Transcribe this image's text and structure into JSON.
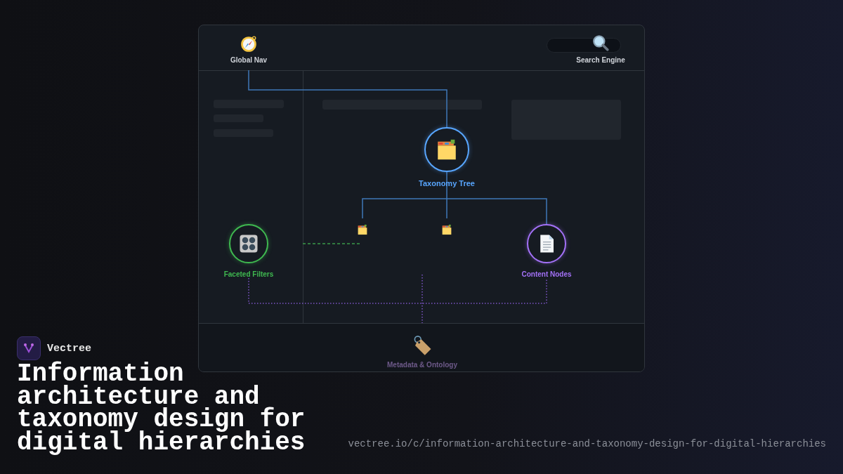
{
  "diagram": {
    "nodes": [
      {
        "label": "Global Nav",
        "kind": "plain",
        "color": "#d0d4da"
      },
      {
        "label": "Search Engine",
        "kind": "plain",
        "color": "#d0d4da"
      },
      {
        "label": "Taxonomy Tree",
        "kind": "circle",
        "color": "#58a6ff"
      },
      {
        "label": "Faceted Filters",
        "kind": "circle",
        "color": "#3fb950"
      },
      {
        "label": "Content Nodes",
        "kind": "circle",
        "color": "#a371f7"
      },
      {
        "label": "Metadata & Ontology",
        "kind": "plain",
        "color": "#6e5a8a"
      }
    ]
  },
  "brand": {
    "name": "Vectree"
  },
  "title": "Information architecture and taxonomy design for digital hierarchies",
  "url": "vectree.io/c/information-architecture-and-taxonomy-design-for-digital-hierarchies"
}
